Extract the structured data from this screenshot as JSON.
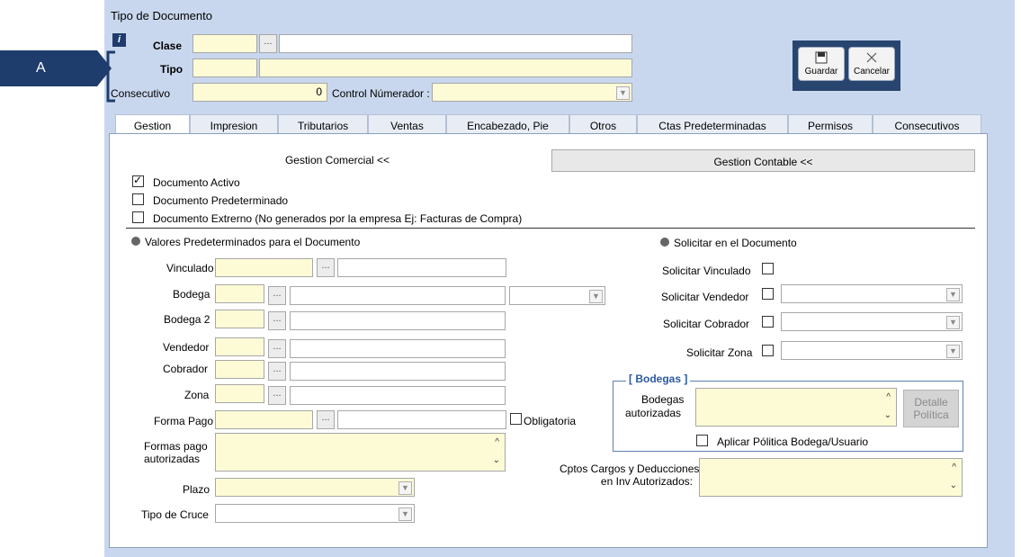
{
  "window": {
    "title": "Tipo de Documento"
  },
  "callout": {
    "label": "A"
  },
  "header": {
    "clase_label": "Clase",
    "tipo_label": "Tipo",
    "consecutivo_label": "Consecutivo",
    "consecutivo_value": "0",
    "control_label": "Control Númerador :",
    "dots": "..."
  },
  "actions": {
    "guardar": "Guardar",
    "cancelar": "Cancelar"
  },
  "tabs": [
    "Gestion",
    "Impresion",
    "Tributarios",
    "Ventas",
    "Encabezado, Pie",
    "Otros",
    "Ctas Predeterminadas",
    "Permisos",
    "Consecutivos"
  ],
  "subtabs": {
    "comercial": "Gestion Comercial <<",
    "contable": "Gestion Contable <<"
  },
  "checks": {
    "activo": "Documento Activo",
    "predeterminado": "Documento Predeterminado",
    "externo": "Documento Extrerno (No generados por la empresa  Ej: Facturas de Compra)"
  },
  "sections": {
    "valores": "Valores Predeterminados para el Documento",
    "solicitar": "Solicitar en el Documento"
  },
  "left": {
    "vinculado": "Vinculado",
    "bodega": "Bodega",
    "bodega2": "Bodega 2",
    "vendedor": "Vendedor",
    "cobrador": "Cobrador",
    "zona": "Zona",
    "forma_pago": "Forma Pago",
    "obligatoria": "Obligatoria",
    "formas_pago_1": "Formas pago",
    "formas_pago_2": "autorizadas",
    "plazo": "Plazo",
    "tipo_cruce": "Tipo de Cruce"
  },
  "right": {
    "vinculado": "Solicitar Vinculado",
    "vendedor": "Solicitar Vendedor",
    "cobrador": "Solicitar Cobrador",
    "zona": "Solicitar Zona",
    "bodegas_group": "[ Bodegas ]",
    "bodegas_1": "Bodegas",
    "bodegas_2": "autorizadas",
    "detalle_1": "Detalle",
    "detalle_2": "Política",
    "aplicar": "Aplicar Pólitica Bodega/Usuario",
    "cptos_1": "Cptos Cargos y Deducciones",
    "cptos_2": "en Inv Autorizados:"
  }
}
